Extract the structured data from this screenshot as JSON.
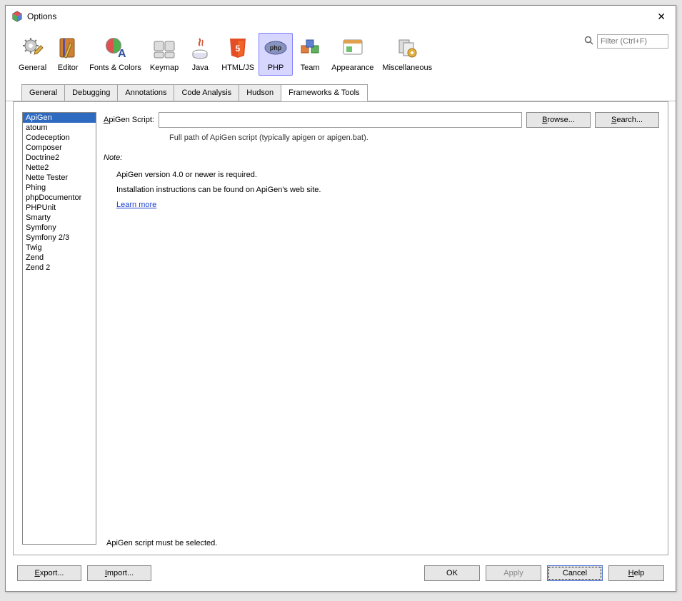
{
  "window": {
    "title": "Options"
  },
  "filter": {
    "placeholder": "Filter (Ctrl+F)"
  },
  "categories": [
    {
      "id": "general",
      "label": "General"
    },
    {
      "id": "editor",
      "label": "Editor"
    },
    {
      "id": "fonts",
      "label": "Fonts & Colors"
    },
    {
      "id": "keymap",
      "label": "Keymap"
    },
    {
      "id": "java",
      "label": "Java"
    },
    {
      "id": "htmljs",
      "label": "HTML/JS"
    },
    {
      "id": "php",
      "label": "PHP",
      "selected": true
    },
    {
      "id": "team",
      "label": "Team"
    },
    {
      "id": "appearance",
      "label": "Appearance"
    },
    {
      "id": "misc",
      "label": "Miscellaneous"
    }
  ],
  "tabs": [
    {
      "label": "General"
    },
    {
      "label": "Debugging"
    },
    {
      "label": "Annotations"
    },
    {
      "label": "Code Analysis"
    },
    {
      "label": "Hudson"
    },
    {
      "label": "Frameworks & Tools",
      "active": true
    }
  ],
  "frameworks": [
    "ApiGen",
    "atoum",
    "Codeception",
    "Composer",
    "Doctrine2",
    "Nette2",
    "Nette Tester",
    "Phing",
    "phpDocumentor",
    "PHPUnit",
    "Smarty",
    "Symfony",
    "Symfony 2/3",
    "Twig",
    "Zend",
    "Zend 2"
  ],
  "framework_selected_index": 0,
  "detail": {
    "script_label": "ApiGen Script:",
    "script_value": "",
    "browse": "Browse...",
    "search": "Search...",
    "hint": "Full path of ApiGen script (typically apigen or apigen.bat).",
    "note_head": "Note:",
    "note_line1": "ApiGen version 4.0 or newer is required.",
    "note_line2": "Installation instructions can be found on ApiGen's web site.",
    "learn_more": "Learn more",
    "status": "ApiGen script must be selected."
  },
  "buttons": {
    "export": "Export...",
    "import": "Import...",
    "ok": "OK",
    "apply": "Apply",
    "cancel": "Cancel",
    "help": "Help"
  }
}
